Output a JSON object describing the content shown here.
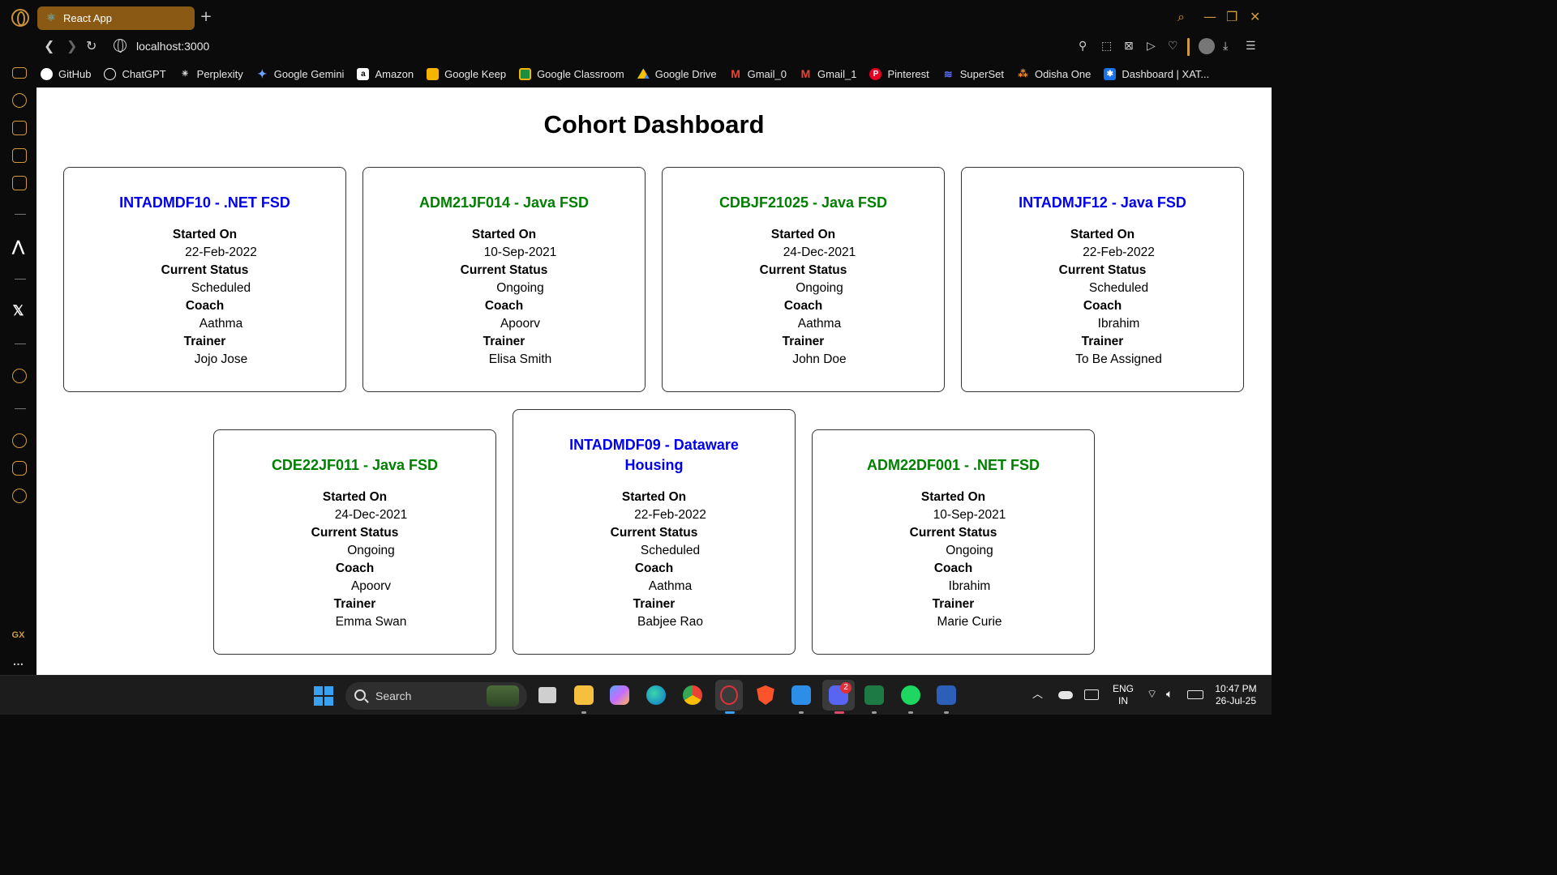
{
  "browser": {
    "tab_title": "React App",
    "url": "localhost:3000",
    "bookmarks": [
      {
        "label": "GitHub",
        "icon": "github-icon",
        "color": "#ffffff"
      },
      {
        "label": "ChatGPT",
        "icon": "chatgpt-icon",
        "color": "#ffffff"
      },
      {
        "label": "Perplexity",
        "icon": "perplexity-icon",
        "color": "#ffffff"
      },
      {
        "label": "Google Gemini",
        "icon": "gemini-icon",
        "color": "#6ba3ff"
      },
      {
        "label": "Amazon",
        "icon": "amazon-icon",
        "color": "#ffffff"
      },
      {
        "label": "Google Keep",
        "icon": "keep-icon",
        "color": "#f4b400"
      },
      {
        "label": "Google Classroom",
        "icon": "classroom-icon",
        "color": "#1e8e3e"
      },
      {
        "label": "Google Drive",
        "icon": "drive-icon",
        "color": "#34a853"
      },
      {
        "label": "Gmail_0",
        "icon": "gmail-icon",
        "color": "#ea4335"
      },
      {
        "label": "Gmail_1",
        "icon": "gmail-icon",
        "color": "#ea4335"
      },
      {
        "label": "Pinterest",
        "icon": "pinterest-icon",
        "color": "#e60023"
      },
      {
        "label": "SuperSet",
        "icon": "superset-icon",
        "color": "#5b6bff"
      },
      {
        "label": "Odisha One",
        "icon": "odisha-one-icon",
        "color": "#f08a24"
      },
      {
        "label": "Dashboard | XAT...",
        "icon": "xat-icon",
        "color": "#1a73e8"
      }
    ]
  },
  "sidebar": {
    "gx_label": "GX",
    "more_label": "…"
  },
  "dashboard": {
    "title": "Cohort Dashboard",
    "labels": {
      "started": "Started On",
      "status": "Current Status",
      "coach": "Coach",
      "trainer": "Trainer"
    },
    "cohorts": [
      {
        "name": "INTADMDF10 - .NET FSD",
        "name_color": "#0000ee",
        "started": "22-Feb-2022",
        "status": "Scheduled",
        "coach": "Aathma",
        "trainer": "Jojo Jose"
      },
      {
        "name": "ADM21JF014 - Java FSD",
        "name_color": "#008000",
        "started": "10-Sep-2021",
        "status": "Ongoing",
        "coach": "Apoorv",
        "trainer": "Elisa Smith"
      },
      {
        "name": "CDBJF21025 - Java FSD",
        "name_color": "#008000",
        "started": "24-Dec-2021",
        "status": "Ongoing",
        "coach": "Aathma",
        "trainer": "John Doe"
      },
      {
        "name": "INTADMJF12 - Java FSD",
        "name_color": "#0000ee",
        "started": "22-Feb-2022",
        "status": "Scheduled",
        "coach": "Ibrahim",
        "trainer": "To Be Assigned"
      },
      {
        "name": "CDE22JF011 - Java FSD",
        "name_color": "#008000",
        "started": "24-Dec-2021",
        "status": "Ongoing",
        "coach": "Apoorv",
        "trainer": "Emma Swan"
      },
      {
        "name": "INTADMDF09 - Dataware Housing",
        "name_color": "#0000ee",
        "started": "22-Feb-2022",
        "status": "Scheduled",
        "coach": "Aathma",
        "trainer": "Babjee Rao"
      },
      {
        "name": "ADM22DF001 - .NET FSD",
        "name_color": "#008000",
        "started": "10-Sep-2021",
        "status": "Ongoing",
        "coach": "Ibrahim",
        "trainer": "Marie Curie"
      }
    ]
  },
  "taskbar": {
    "search_label": "Search",
    "lang_top": "ENG",
    "lang_bottom": "IN",
    "time": "10:47 PM",
    "date": "26-Jul-25",
    "discord_badge": "2"
  }
}
